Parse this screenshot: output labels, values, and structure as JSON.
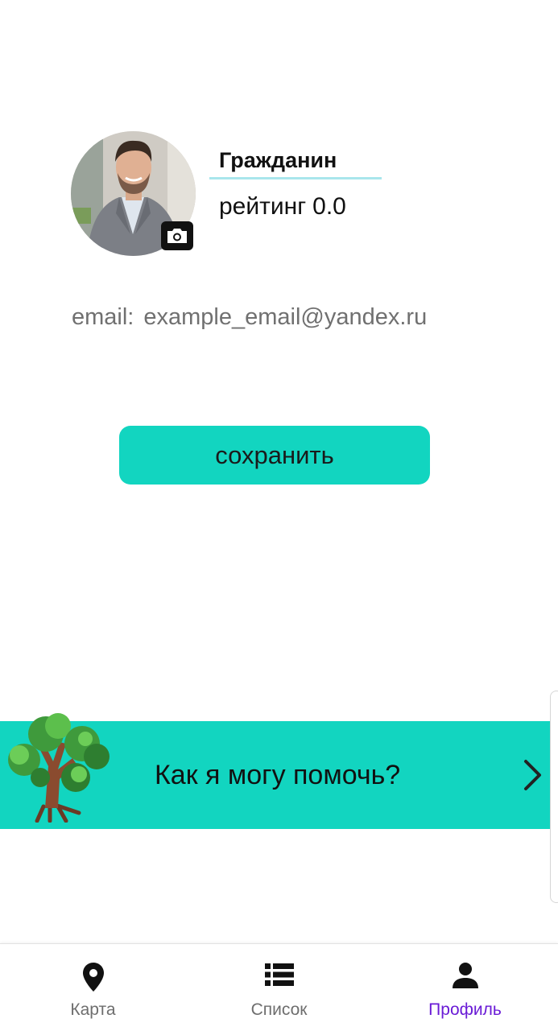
{
  "profile": {
    "name": "Гражданин",
    "rating_label": "рейтинг",
    "rating_value": "0.0",
    "email_label": "email:",
    "email_value": "example_email@yandex.ru",
    "avatar_icon": "user-photo",
    "camera_icon": "camera-icon"
  },
  "actions": {
    "save_label": "сохранить"
  },
  "help_banner": {
    "text": "Как я могу помочь?",
    "icon": "tree-icon",
    "arrow_icon": "chevron-right-icon"
  },
  "bottom_nav": {
    "items": [
      {
        "label": "Карта",
        "icon": "map-pin-icon",
        "active": false
      },
      {
        "label": "Список",
        "icon": "list-icon",
        "active": false
      },
      {
        "label": "Профиль",
        "icon": "person-icon",
        "active": true
      }
    ]
  },
  "colors": {
    "accent": "#12d5c0",
    "active_nav": "#6a1bd6",
    "inactive_nav": "#6e6e6e",
    "underline": "#a9e6ec"
  }
}
